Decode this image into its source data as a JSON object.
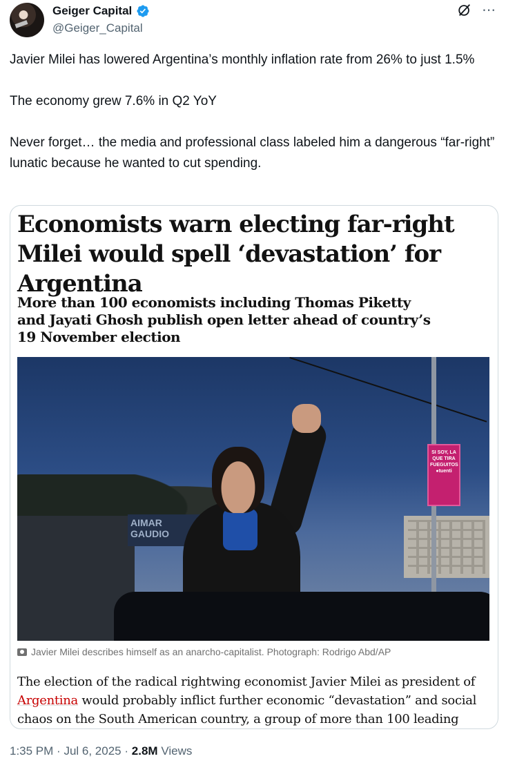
{
  "tweet": {
    "author_name": "Geiger Capital",
    "handle": "@Geiger_Capital",
    "text_p1": "Javier Milei has lowered Argentina’s monthly inflation rate from 26% to just 1.5%",
    "text_p2": "The economy grew 7.6% in Q2 YoY",
    "text_p3": "Never forget… the media and professional class labeled him a dangerous “far-right” lunatic because he wanted to cut spending.",
    "time": "1:35 PM",
    "separator": "·",
    "date": "Jul 6, 2025",
    "views_count": "2.8M",
    "views_label": "Views",
    "more_icon": "⋯"
  },
  "article": {
    "headline": "Economists warn electing far-right Milei would spell ‘devastation’ for Argentina",
    "standfirst": "More than 100 economists including Thomas Piketty and Jayati Ghosh publish open letter ahead of country’s 19 November election",
    "caption": "Javier Milei describes himself as an anarcho-capitalist. Photograph: Rodrigo Abd/AP",
    "body_before": "The election of the radical rightwing economist Javier Milei as president of ",
    "body_link": "Argentina",
    "body_after": " would probably inflict further economic “devastation” and social chaos on the South American country, a group of more than 100 leading",
    "photo_sign": "AIMAR\nGAUDIO",
    "photo_banner": "SI SOY, LA QUE TIRA FUEGUITOS ●tuenti"
  },
  "colors": {
    "verified": "#1d9bf0",
    "link_red": "#c70000",
    "muted": "#536471"
  }
}
